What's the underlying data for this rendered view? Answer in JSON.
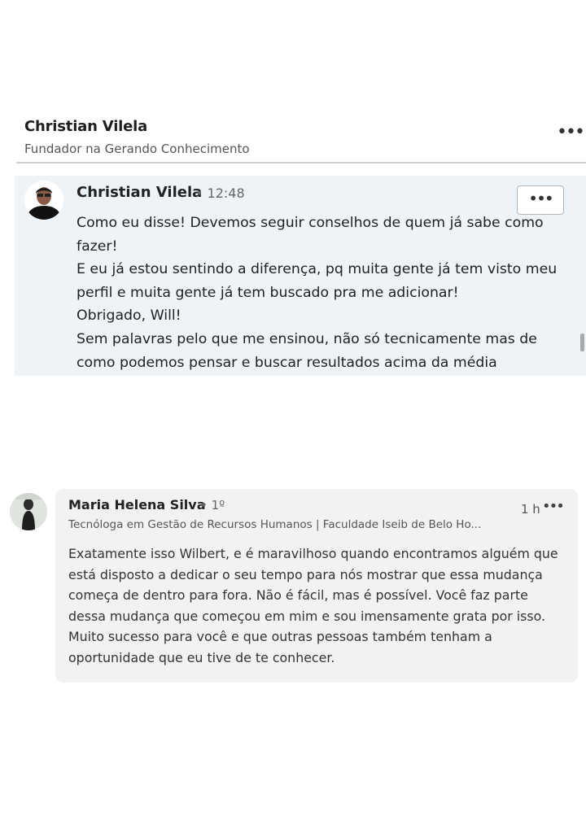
{
  "post_header": {
    "author": "Christian Vilela",
    "subtitle": "Fundador na Gerando Conhecimento",
    "more_icon": "more-horizontal-icon"
  },
  "message": {
    "author": "Christian Vilela",
    "time": "• 12:48",
    "more_label": "•••",
    "lines": [
      "Como eu disse! Devemos seguir conselhos de quem já sabe como fazer!",
      "E eu já estou sentindo a diferença, pq muita gente já tem visto meu perfil e muita gente já tem buscado pra me adicionar!",
      "Obrigado, Will!",
      "Sem palavras pelo que me ensinou, não só tecnicamente mas de como podemos pensar e buscar resultados acima da média"
    ]
  },
  "comment": {
    "author": "Maria Helena Silva",
    "degree": "• 1º",
    "time": "1 h",
    "more_label": "•••",
    "headline": "Tecnóloga em Gestão de Recursos Humanos | Faculdade Iseib de Belo Ho...",
    "text": "Exatamente isso Wilbert, e é maravilhoso quando encontramos alguém que está disposto a dedicar o seu tempo para nós mostrar que essa mudança começa de dentro para fora. Não é fácil, mas é possível. Você faz parte dessa mudança que começou em mim e sou imensamente grata por isso. Muito sucesso para você e que outras pessoas também tenham a oportunidade que eu tive de te conhecer."
  }
}
